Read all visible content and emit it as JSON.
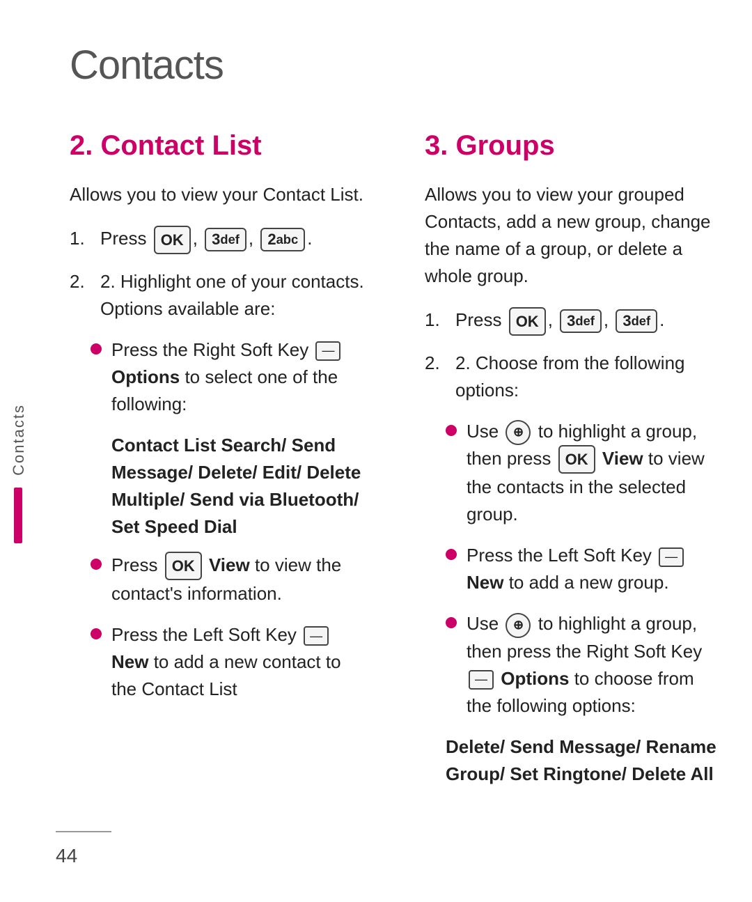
{
  "page": {
    "title": "Contacts",
    "page_number": "44",
    "side_tab_label": "Contacts"
  },
  "section2": {
    "heading": "2. Contact List",
    "intro": "Allows you to view your Contact List.",
    "step1_prefix": "1. Press",
    "step2_prefix": "2. Highlight one of your contacts. Options available are:",
    "bullet1_text": "Press the Right Soft Key",
    "bullet1_icon_label": "Options",
    "bullet1_suffix": "to select one of the following:",
    "bold_block": "Contact List Search/ Send Message/ Delete/ Edit/ Delete Multiple/ Send via Bluetooth/ Set Speed Dial",
    "bullet2_text_prefix": "Press",
    "bullet2_ok_label": "View",
    "bullet2_text_suffix": "to view the contact's information.",
    "bullet3_text": "Press the Left Soft Key",
    "bullet3_icon_label": "New",
    "bullet3_suffix": "to add a new contact to the Contact List"
  },
  "section3": {
    "heading": "3. Groups",
    "intro": "Allows you to view your grouped Contacts, add a new group, change the name of a group, or delete a whole group.",
    "step1_prefix": "1. Press",
    "step2_prefix": "2. Choose from the following options:",
    "bullet1_text_prefix": "Use",
    "bullet1_text_middle": "to highlight a group, then press",
    "bullet1_ok_label": "View",
    "bullet1_text_suffix": "to view the contacts in the selected group.",
    "bullet2_text": "Press the Left Soft Key",
    "bullet2_icon_label": "New",
    "bullet2_suffix": "to add a new group.",
    "bullet3_text_prefix": "Use",
    "bullet3_text_middle": "to highlight a group, then press the Right Soft Key",
    "bullet3_icon_label": "Options",
    "bullet3_text_suffix": "to choose from the following options:",
    "bold_block": "Delete/ Send Message/ Rename Group/ Set Ringtone/ Delete All"
  }
}
